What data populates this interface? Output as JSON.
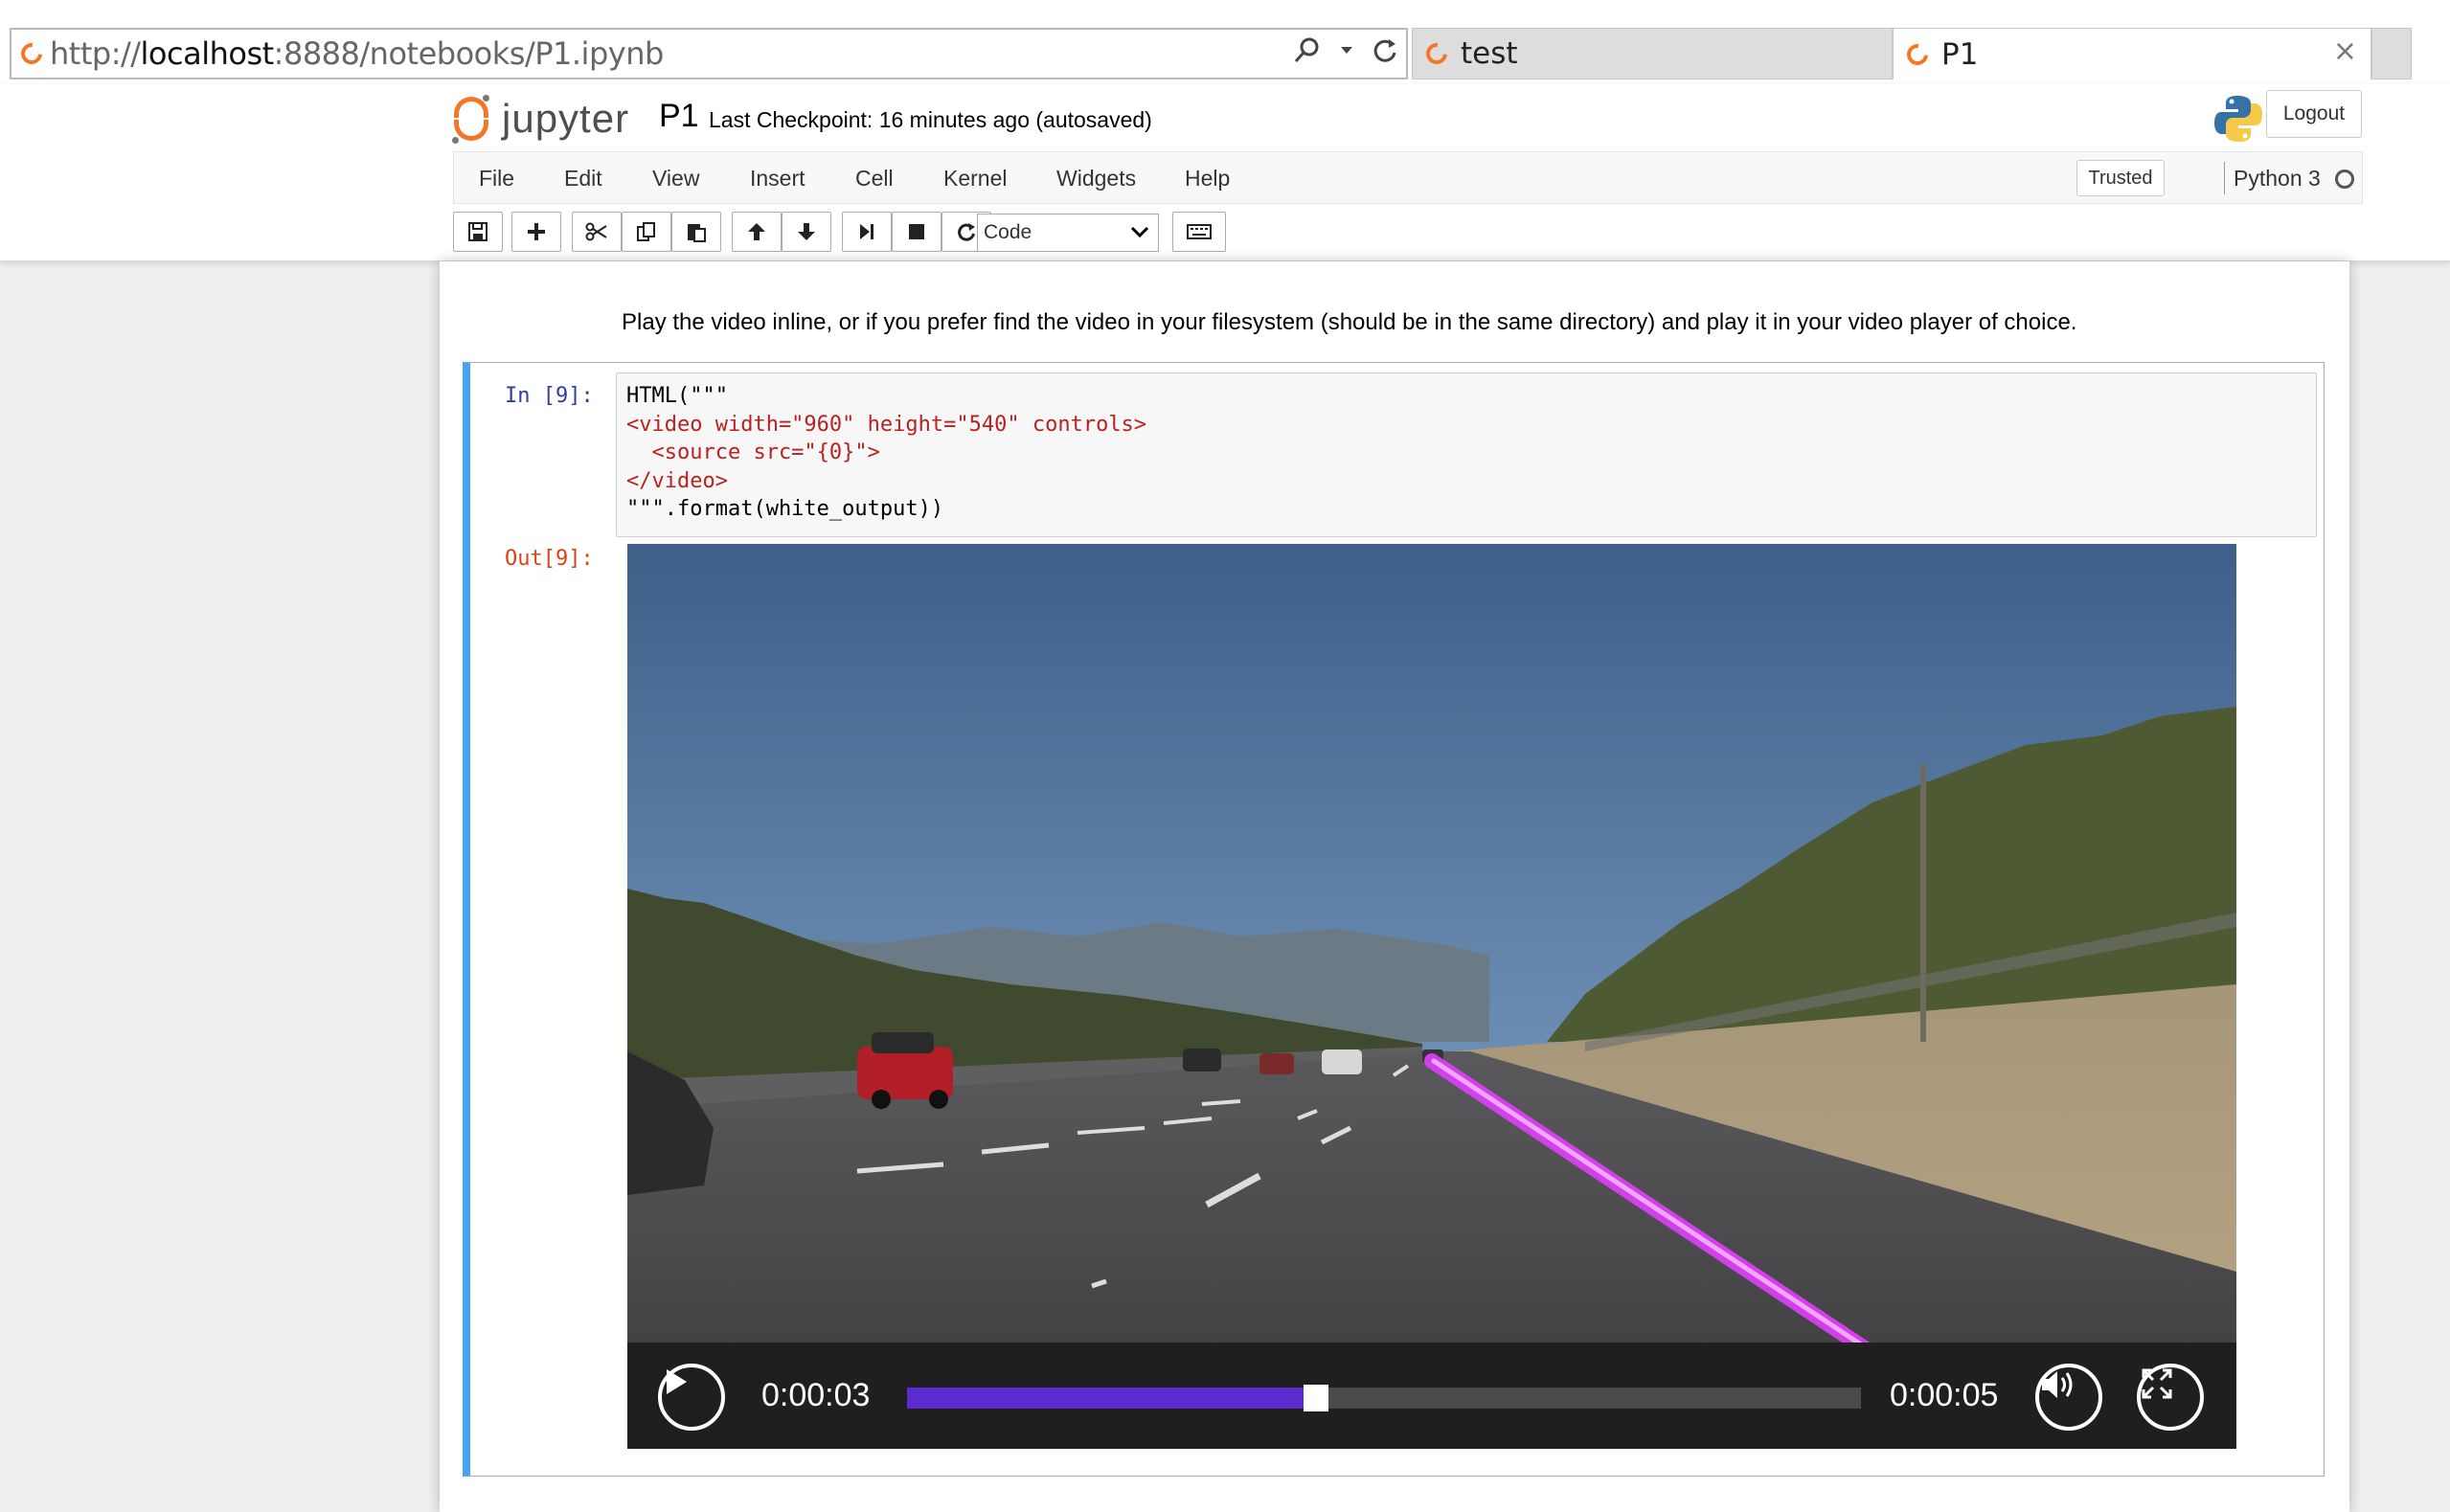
{
  "browser": {
    "url_prefix": "http://",
    "url_host": "localhost",
    "url_rest": ":8888/notebooks/P1.ipynb",
    "tabs": [
      {
        "title": "test",
        "active": false
      },
      {
        "title": "P1",
        "active": true
      }
    ],
    "close_glyph": "×"
  },
  "header": {
    "logo_text": "jupyter",
    "notebook_name": "P1",
    "checkpoint": "Last Checkpoint: 16 minutes ago (autosaved)",
    "logout_label": "Logout"
  },
  "menu": {
    "items": [
      "File",
      "Edit",
      "View",
      "Insert",
      "Cell",
      "Kernel",
      "Widgets",
      "Help"
    ],
    "trusted_label": "Trusted",
    "kernel_name": "Python 3"
  },
  "toolbar": {
    "cell_type": "Code",
    "icons": [
      "save-icon",
      "plus-icon",
      "cut-icon",
      "copy-icon",
      "paste-icon",
      "arrow-up-icon",
      "arrow-down-icon",
      "step-forward-icon",
      "stop-icon",
      "refresh-icon",
      "keyboard-icon"
    ]
  },
  "notebook": {
    "markdown_text": "Play the video inline, or if you prefer find the video in your filesystem (should be in the same directory) and play it in your video player of choice.",
    "cell": {
      "in_prompt": "In [9]:",
      "out_prompt": "Out[9]:",
      "code_lines": [
        "HTML(\"\"\"",
        "<video width=\"960\" height=\"540\" controls>",
        "  <source src=\"{0}\">",
        "</video>",
        "\"\"\".format(white_output))"
      ]
    }
  },
  "video": {
    "current_time": "0:00:03",
    "duration": "0:00:05",
    "progress_fraction": 0.42,
    "progress_color": "#5b2bd0",
    "lane_color": "#e040fb"
  },
  "colors": {
    "jupyter_orange": "#f37726",
    "cell_selected": "#42a5f5",
    "in_prompt": "#303f9f",
    "out_prompt": "#d84315"
  }
}
